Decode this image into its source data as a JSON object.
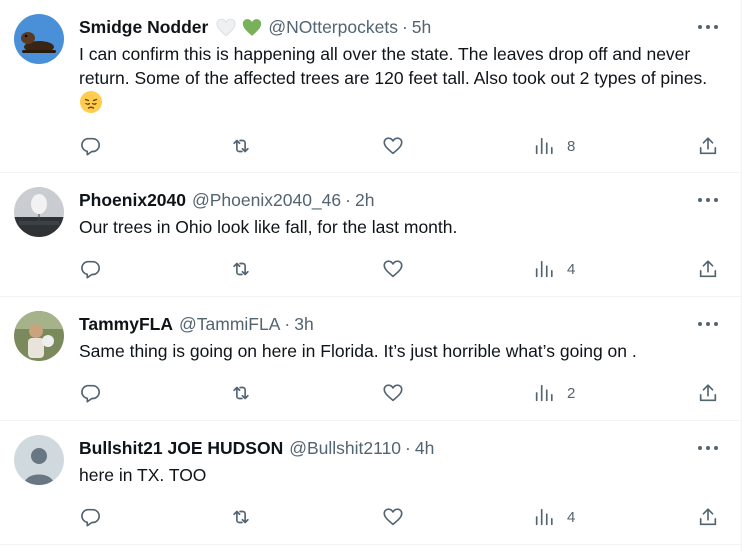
{
  "tweets": [
    {
      "name": "Smidge Nodder",
      "handle": "@NOtterpockets",
      "time": "5h",
      "text": "I can confirm this is happening all over the state. The leaves drop off and never return. Some of the affected trees are 120 feet tall. Also took out 2 types of pines.",
      "views": "8",
      "avatar_icon": "otter-avatar-icon",
      "emoji_icon": "pensive-face-icon",
      "badge_icons": [
        "white-heart-icon",
        "green-heart-icon"
      ]
    },
    {
      "name": "Phoenix2040",
      "handle": "@Phoenix2040_46",
      "time": "2h",
      "text": "Our trees in Ohio look like fall, for the last month.",
      "views": "4",
      "avatar_icon": "balloon-avatar-icon"
    },
    {
      "name": "TammyFLA",
      "handle": "@TammiFLA",
      "time": "3h",
      "text": "Same thing is going on here in Florida. It’s just horrible what’s going on .",
      "views": "2",
      "avatar_icon": "photo-avatar-icon"
    },
    {
      "name": "Bullshit21 JOE HUDSON",
      "handle": "@Bullshit2110",
      "time": "4h",
      "text": "here in TX. TOO",
      "views": "4",
      "avatar_icon": "default-avatar-icon"
    }
  ],
  "separator": "·",
  "colors": {
    "text_primary": "#0f1419",
    "text_secondary": "#536471",
    "divider": "#eff3f4",
    "green_heart": "#78b159"
  }
}
